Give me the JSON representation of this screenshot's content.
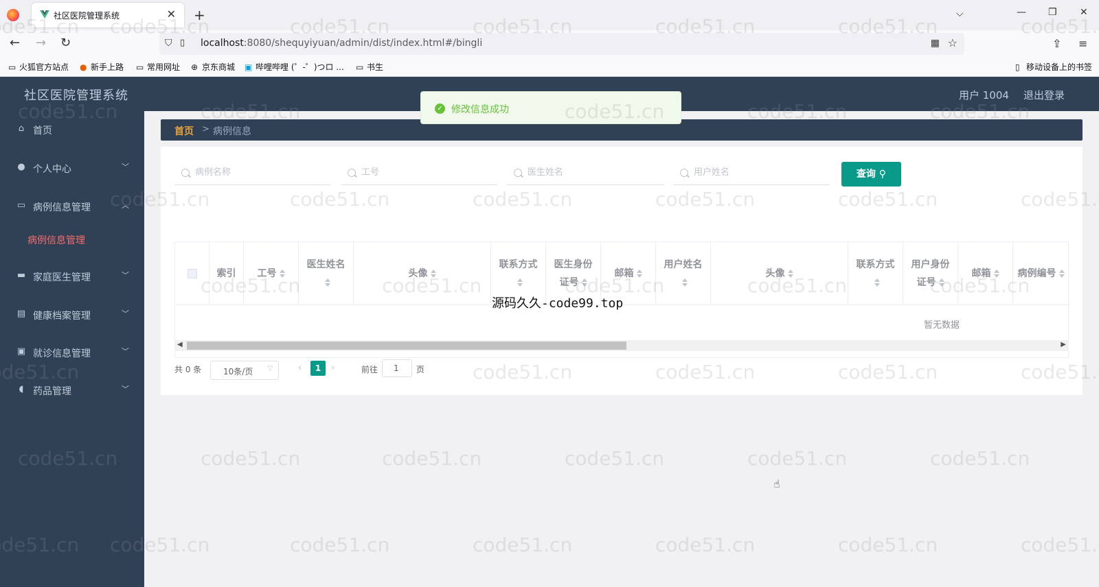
{
  "browser": {
    "tab_title": "社区医院管理系统",
    "url_host": "localhost",
    "url_path": ":8080/shequyiyuan/admin/dist/index.html#/bingli",
    "bookmarks": [
      "火狐官方站点",
      "新手上路",
      "常用网址",
      "京东商城",
      "哔哩哔哩 (゜-゜)つロ ...",
      "书生"
    ],
    "mobile_bookmarks": "移动设备上的书签"
  },
  "header": {
    "title": "社区医院管理系统",
    "user": "用户 1004",
    "logout": "退出登录"
  },
  "sidebar": {
    "items": [
      {
        "label": "首页",
        "icon": "home-icon"
      },
      {
        "label": "个人中心",
        "icon": "user-icon"
      },
      {
        "label": "病例信息管理",
        "icon": "message-icon"
      },
      {
        "label": "家庭医生管理",
        "icon": "monitor-icon"
      },
      {
        "label": "健康档案管理",
        "icon": "document-icon"
      },
      {
        "label": "就诊信息管理",
        "icon": "clipboard-icon"
      },
      {
        "label": "药品管理",
        "icon": "pill-icon"
      }
    ],
    "active_sub": "病例信息管理"
  },
  "breadcrumb": {
    "home": "首页",
    "sep": ">",
    "current": "病例信息"
  },
  "search": {
    "placeholders": [
      "病例名称",
      "工号",
      "医生姓名",
      "用户姓名"
    ],
    "query_label": "查询"
  },
  "table": {
    "columns": [
      "索引",
      "工号",
      "医生姓名",
      "头像",
      "联系方式",
      "医生身份证号",
      "邮箱",
      "用户姓名",
      "头像",
      "联系方式",
      "用户身份证号",
      "邮箱",
      "病例编号"
    ],
    "empty_text": "暂无数据"
  },
  "pagination": {
    "total": "共 0 条",
    "page_size": "10条/页",
    "current_page": "1",
    "goto_label": "前往",
    "goto_value": "1",
    "page_label": "页"
  },
  "toast": {
    "message": "修改信息成功"
  },
  "overlay": "源码久久-code99.top",
  "watermark": "code51.cn",
  "colors": {
    "sidebar_bg": "#304156",
    "accent": "#0a9a8a",
    "active_menu": "#f56c6c",
    "breadcrumb_home": "#e6a23c",
    "success": "#67c23a"
  }
}
